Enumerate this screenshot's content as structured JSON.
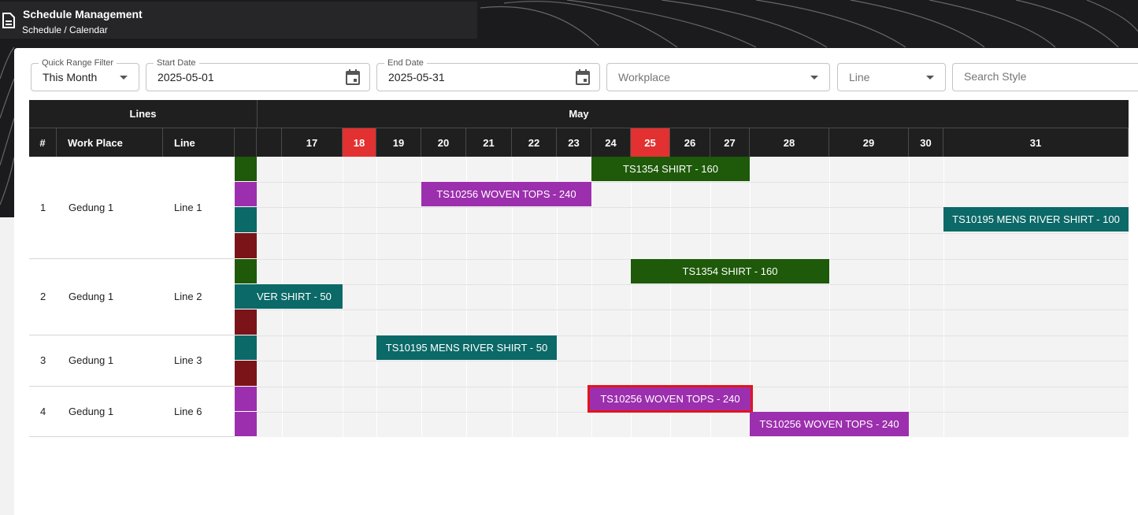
{
  "header": {
    "title": "Schedule Management",
    "breadcrumb": "Schedule / Calendar"
  },
  "filters": {
    "quick_range": {
      "label": "Quick Range Filter",
      "value": "This Month"
    },
    "start_date": {
      "label": "Start Date",
      "value": "2025-05-01"
    },
    "end_date": {
      "label": "End Date",
      "value": "2025-05-31"
    },
    "workplace": {
      "placeholder": "Workplace"
    },
    "line": {
      "placeholder": "Line"
    },
    "search": {
      "placeholder": "Search Style"
    }
  },
  "table": {
    "group_header": "Lines",
    "month": "May",
    "columns": {
      "num": "#",
      "workplace": "Work Place",
      "line": "Line"
    },
    "days": [
      {
        "label": "17",
        "weekend": false
      },
      {
        "label": "18",
        "weekend": true
      },
      {
        "label": "19",
        "weekend": false
      },
      {
        "label": "20",
        "weekend": false
      },
      {
        "label": "21",
        "weekend": false
      },
      {
        "label": "22",
        "weekend": false
      },
      {
        "label": "23",
        "weekend": false
      },
      {
        "label": "24",
        "weekend": false
      },
      {
        "label": "25",
        "weekend": true
      },
      {
        "label": "26",
        "weekend": false
      },
      {
        "label": "27",
        "weekend": false
      },
      {
        "label": "28",
        "weekend": false
      },
      {
        "label": "29",
        "weekend": false
      },
      {
        "label": "30",
        "weekend": false
      },
      {
        "label": "31",
        "weekend": false
      }
    ],
    "rows": [
      {
        "num": "1",
        "workplace": "Gedung 1",
        "line": "Line 1"
      },
      {
        "num": "2",
        "workplace": "Gedung 1",
        "line": "Line 2"
      },
      {
        "num": "3",
        "workplace": "Gedung 1",
        "line": "Line 3"
      },
      {
        "num": "4",
        "workplace": "Gedung 1",
        "line": "Line 6"
      }
    ]
  },
  "colors": {
    "green": "#1e5a09",
    "purple": "#9c2fae",
    "teal": "#0b6968",
    "maroon": "#7b1418",
    "weekend": "#e23130",
    "selected_outline": "#e3141b"
  },
  "bars": [
    {
      "text": "TS1354 SHIRT - 160",
      "color": "green"
    },
    {
      "text": "TS10256 WOVEN TOPS - 240",
      "color": "purple"
    },
    {
      "text": "TS10195 MENS RIVER SHIRT - 100",
      "color": "teal"
    },
    {
      "text": "TS1354 SHIRT - 160",
      "color": "green"
    },
    {
      "text": "VER SHIRT - 50",
      "color": "teal"
    },
    {
      "text": "TS10195 MENS RIVER SHIRT - 50",
      "color": "teal"
    },
    {
      "text": "TS10256 WOVEN TOPS - 240",
      "color": "purple",
      "selected": true
    },
    {
      "text": "TS10256 WOVEN TOPS - 240",
      "color": "purple"
    }
  ]
}
